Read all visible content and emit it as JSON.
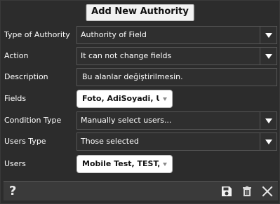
{
  "dialog": {
    "title": "Add New Authority"
  },
  "fields": {
    "type_of_authority": {
      "label": "Type of Authority",
      "value": "Authority of Field"
    },
    "action": {
      "label": "Action",
      "value": "It can not change fields"
    },
    "description": {
      "label": "Description",
      "value": "Bu alanlar değiştirilmesin."
    },
    "fields": {
      "label": "Fields",
      "value": "Foto, AdiSoyadi, U..."
    },
    "condition_type": {
      "label": "Condition Type",
      "value": "Manually select users..."
    },
    "users_type": {
      "label": "Users Type",
      "value": "Those selected"
    },
    "users": {
      "label": "Users",
      "value": "Mobile Test, TEST,..."
    }
  },
  "footer": {
    "help_label": "?",
    "icons": [
      "save-icon",
      "trash-icon",
      "close-icon"
    ]
  },
  "colors": {
    "background": "#2c2c2c",
    "input_border": "#565656",
    "footer_bg": "#3a3a3a"
  }
}
